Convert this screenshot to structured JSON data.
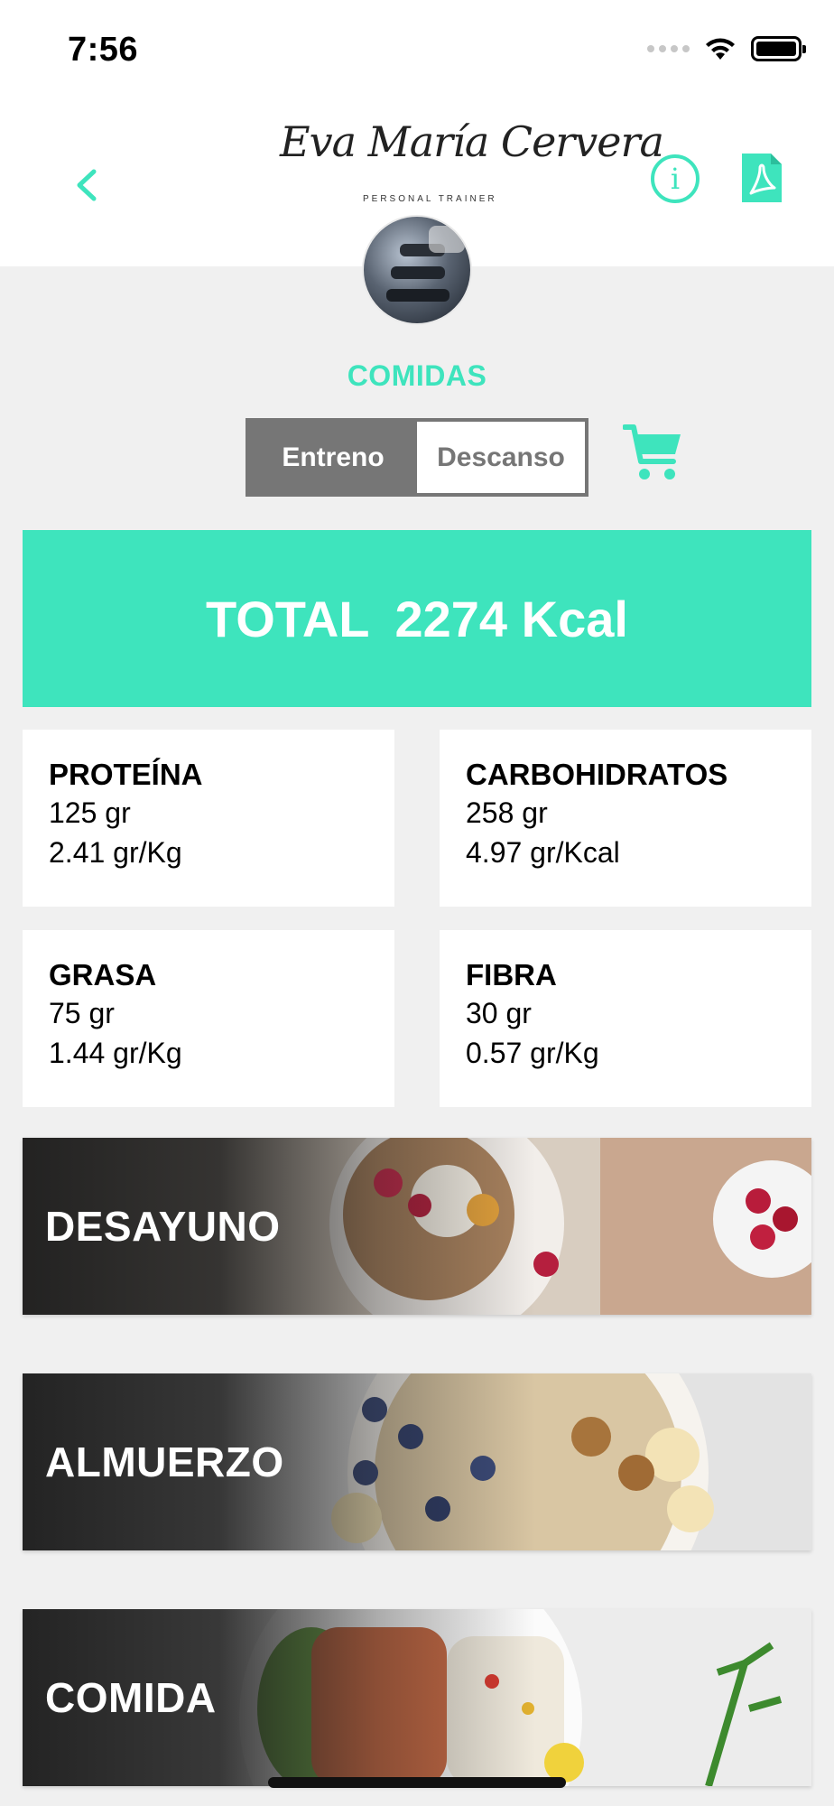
{
  "status_bar": {
    "time": "7:56"
  },
  "header": {
    "logo_script": "Eva María Cervera",
    "logo_subtitle": "PERSONAL TRAINER"
  },
  "section_title": "COMIDAS",
  "segment": {
    "options": [
      "Entreno",
      "Descanso"
    ],
    "selected": "Entreno"
  },
  "total": {
    "label": "TOTAL",
    "value": "2274 Kcal"
  },
  "macros": [
    {
      "name": "PROTEÍNA",
      "grams": "125 gr",
      "ratio": "2.41 gr/Kg"
    },
    {
      "name": "CARBOHIDRATOS",
      "grams": "258 gr",
      "ratio": "4.97 gr/Kcal"
    },
    {
      "name": "GRASA",
      "grams": "75 gr",
      "ratio": "1.44 gr/Kg"
    },
    {
      "name": "FIBRA",
      "grams": "30 gr",
      "ratio": "0.57 gr/Kg"
    }
  ],
  "meals": [
    {
      "label": "DESAYUNO"
    },
    {
      "label": "ALMUERZO"
    },
    {
      "label": "COMIDA"
    }
  ],
  "icons": [
    "chevron-left-icon",
    "info-icon",
    "pdf-icon",
    "cart-icon",
    "wifi-icon",
    "battery-icon"
  ],
  "colors": {
    "accent": "#3ee4bd",
    "segment_gray": "#767676",
    "background": "#f0f0f0"
  }
}
